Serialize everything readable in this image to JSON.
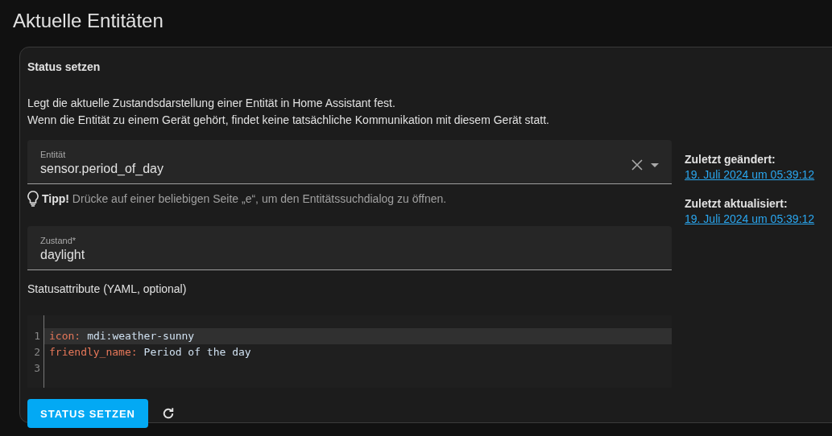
{
  "page_title": "Aktuelle Entitäten",
  "card": {
    "title": "Status setzen",
    "description": [
      "Legt die aktuelle Zustandsdarstellung einer Entität in Home Assistant fest.",
      "Wenn die Entität zu einem Gerät gehört, findet keine tatsächliche Kommunikation mit diesem Gerät statt."
    ],
    "entity_field": {
      "label": "Entität",
      "value": "sensor.period_of_day"
    },
    "hint": "**Tipp!** Drücke auf einer beliebigen Seite „e“, um den Entitätssuchdialog zu öffnen.",
    "state_field": {
      "label": "Zustand*",
      "value": "daylight"
    },
    "attributes_label": "Statusattribute (YAML, optional)",
    "code_lines": [
      {
        "number": "1",
        "key": "icon:",
        "value": "mdi:weather-sunny",
        "selected": true
      },
      {
        "number": "2",
        "key": "friendly_name:",
        "value": "Period of the day",
        "selected": false
      },
      {
        "number": "3",
        "selected": false
      }
    ],
    "button": "STATUS SETZEN",
    "info": [
      {
        "label": "Zuletzt geändert:",
        "link": "19. Juli 2024 um 05:39:12"
      },
      {
        "label": "Zuletzt aktualisiert:",
        "link": "19. Juli 2024 um 05:39:12"
      }
    ]
  }
}
